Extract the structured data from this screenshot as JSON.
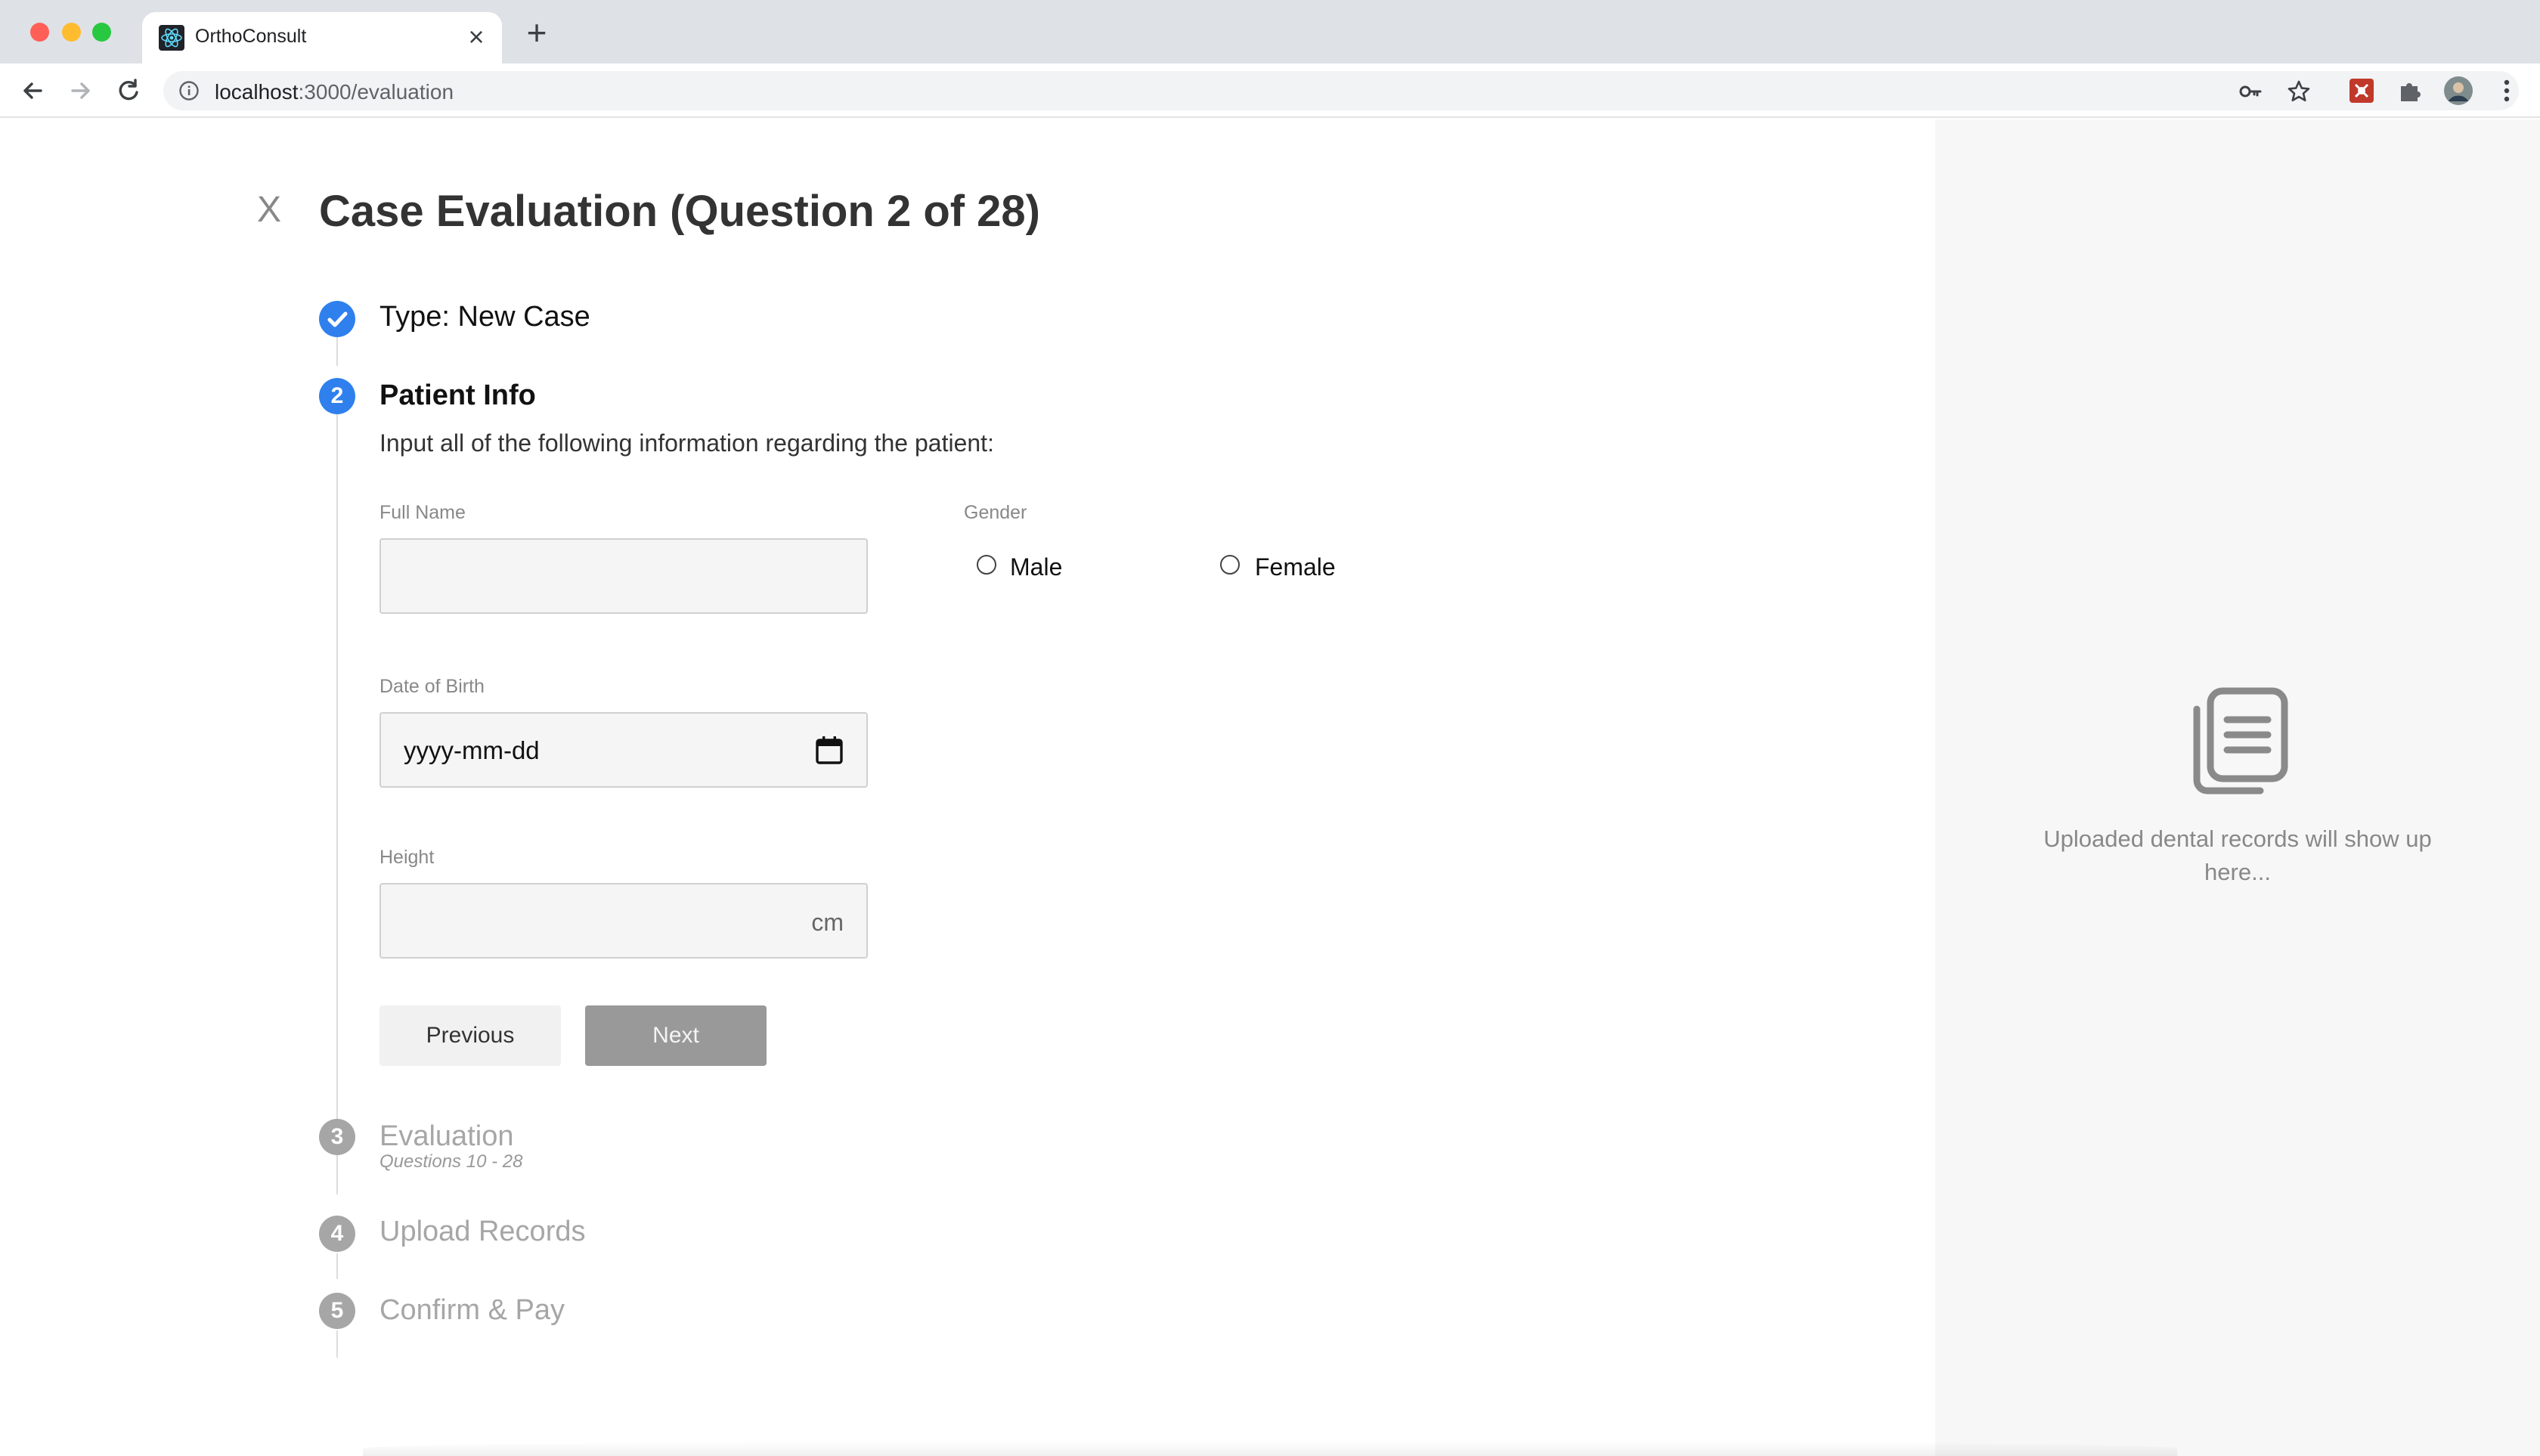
{
  "browser": {
    "tab_title": "OrthoConsult",
    "tab_close": "×",
    "new_tab": "+",
    "url_host": "localhost",
    "url_path": ":3000/evaluation"
  },
  "header": {
    "close_label": "X",
    "title": "Case Evaluation (Question 2 of 28)"
  },
  "steps": [
    {
      "number": "1",
      "title": "Type: New Case",
      "status": "done"
    },
    {
      "number": "2",
      "title": "Patient Info",
      "status": "current"
    },
    {
      "number": "3",
      "title": "Evaluation",
      "status": "future",
      "subtitle": "Questions 10 - 28"
    },
    {
      "number": "4",
      "title": "Upload Records",
      "status": "future"
    },
    {
      "number": "5",
      "title": "Confirm & Pay",
      "status": "future"
    }
  ],
  "form": {
    "instructions": "Input all of the following information regarding the patient:",
    "full_name": {
      "label": "Full Name",
      "value": ""
    },
    "gender": {
      "label": "Gender",
      "options": [
        "Male",
        "Female"
      ],
      "selected": null
    },
    "dob": {
      "label": "Date of Birth",
      "placeholder": "yyyy-mm-dd"
    },
    "height": {
      "label": "Height",
      "unit": "cm",
      "value": ""
    },
    "previous_label": "Previous",
    "next_label": "Next"
  },
  "sidepanel": {
    "icon": "documents-icon",
    "message": "Uploaded dental records will show up here..."
  },
  "colors": {
    "accent": "#2f80ed",
    "inactive": "#a6a6a6",
    "next_button": "#999999"
  }
}
